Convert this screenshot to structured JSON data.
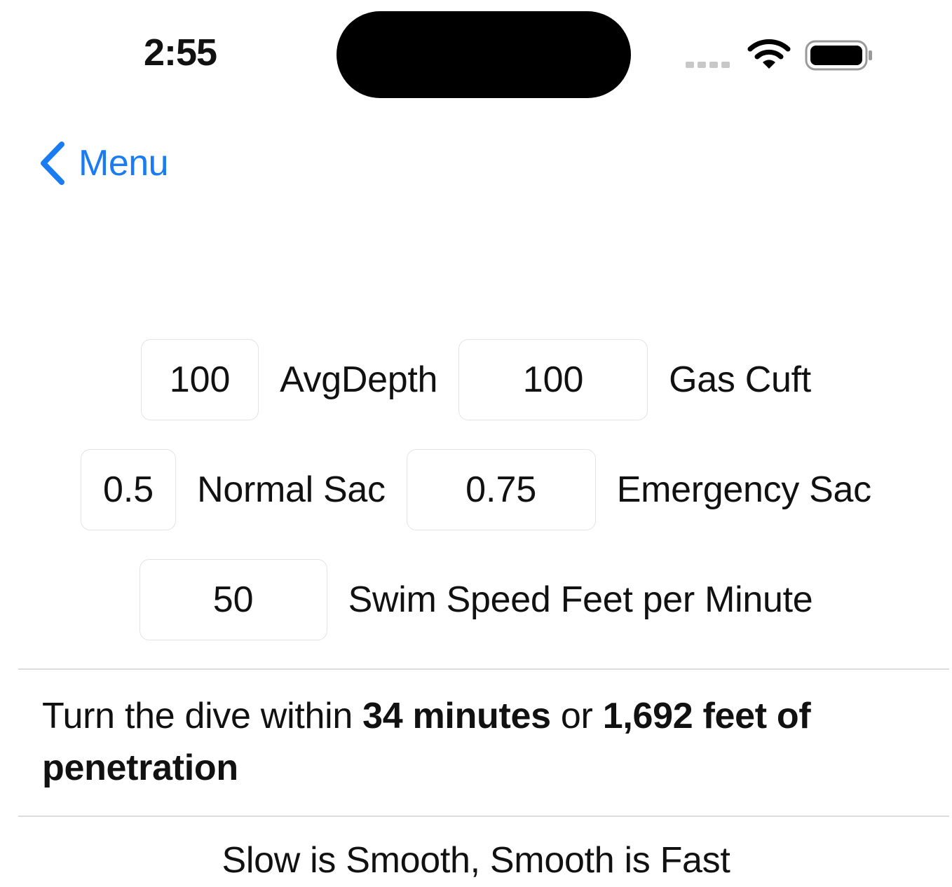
{
  "status_bar": {
    "time": "2:55",
    "icons": [
      "cellular-dots-icon",
      "wifi-icon",
      "battery-icon"
    ]
  },
  "nav": {
    "back_label": "Menu",
    "back_icon": "chevron-left-icon",
    "accent_color": "#1a7cf0"
  },
  "inputs": {
    "avg_depth": {
      "value": "100",
      "label": "AvgDepth"
    },
    "gas_cuft": {
      "value": "100",
      "label": "Gas Cuft"
    },
    "normal_sac": {
      "value": "0.5",
      "label": "Normal Sac"
    },
    "emergency_sac": {
      "value": "0.75",
      "label": "Emergency Sac"
    },
    "swim_speed": {
      "value": "50",
      "label": "Swim Speed Feet per Minute"
    }
  },
  "result": {
    "prefix": "Turn the dive within ",
    "minutes": "34 minutes",
    "middle": " or ",
    "distance": "1,692 feet of penetration"
  },
  "motto": "Slow is Smooth, Smooth is Fast"
}
